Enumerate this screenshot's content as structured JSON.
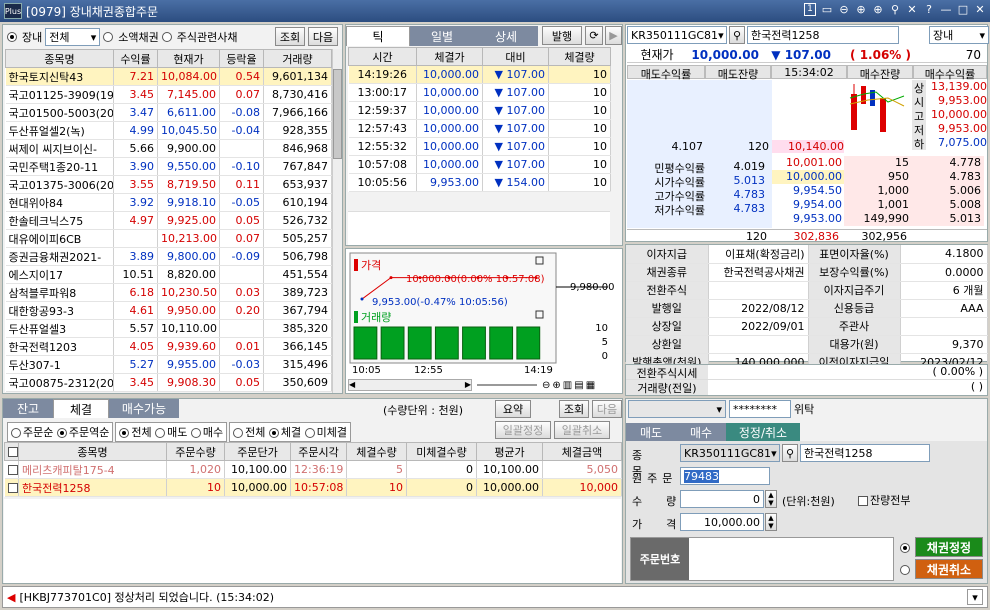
{
  "window": {
    "logo": "Plus",
    "title": "[0979] 장내채권종합주문",
    "controls": [
      "1",
      "▭",
      "⊖",
      "⊕",
      "⊕",
      "⚲",
      "✕",
      "?",
      "—",
      "□",
      "✕"
    ]
  },
  "left": {
    "market_radio": "장내",
    "market_select": "전체",
    "small_radio": "소액채권",
    "stock_radio": "주식관련사채",
    "query_btn": "조회",
    "next_btn": "다음",
    "headers": [
      "종목명",
      "수익률",
      "현재가",
      "등락율",
      "거래량"
    ],
    "rows": [
      {
        "name": "한국토지신탁43",
        "yield": "7.21",
        "price": "10,084.00",
        "chg": "0.54",
        "vol": "9,601,134",
        "color": "red",
        "sel": true
      },
      {
        "name": "국고01125-3909(19-",
        "yield": "3.45",
        "price": "7,145.00",
        "chg": "0.07",
        "vol": "8,730,416",
        "color": "red"
      },
      {
        "name": "국고01500-5003(20-",
        "yield": "3.47",
        "price": "6,611.00",
        "chg": "-0.08",
        "vol": "7,966,166",
        "color": "blue"
      },
      {
        "name": "두산퓨얼셀2(녹)",
        "yield": "4.99",
        "price": "10,045.50",
        "chg": "-0.04",
        "vol": "928,355",
        "color": "blue"
      },
      {
        "name": "써제이 씨지브이신-",
        "yield": "5.66",
        "price": "9,900.00",
        "chg": "",
        "vol": "846,968",
        "color": "black"
      },
      {
        "name": "국민주택1종20-11",
        "yield": "3.90",
        "price": "9,550.00",
        "chg": "-0.10",
        "vol": "767,847",
        "color": "blue"
      },
      {
        "name": "국고01375-3006(20-",
        "yield": "3.55",
        "price": "8,719.50",
        "chg": "0.11",
        "vol": "653,937",
        "color": "red"
      },
      {
        "name": "현대위아84",
        "yield": "3.92",
        "price": "9,918.10",
        "chg": "-0.05",
        "vol": "610,194",
        "color": "blue"
      },
      {
        "name": "한솔테크닉스75",
        "yield": "4.97",
        "price": "9,925.00",
        "chg": "0.05",
        "vol": "526,732",
        "color": "red"
      },
      {
        "name": "대유에이피6CB",
        "yield": "",
        "price": "10,213.00",
        "chg": "0.07",
        "vol": "505,257",
        "color": "red"
      },
      {
        "name": "증권금융채권2021-",
        "yield": "3.89",
        "price": "9,800.00",
        "chg": "-0.09",
        "vol": "506,798",
        "color": "blue"
      },
      {
        "name": "에스지이17",
        "yield": "10.51",
        "price": "8,820.00",
        "chg": "",
        "vol": "451,554",
        "color": "black"
      },
      {
        "name": "삼척블루파워8",
        "yield": "6.18",
        "price": "10,230.50",
        "chg": "0.03",
        "vol": "389,723",
        "color": "red"
      },
      {
        "name": "대한항공93-3",
        "yield": "4.61",
        "price": "9,950.00",
        "chg": "0.20",
        "vol": "367,794",
        "color": "red"
      },
      {
        "name": "두산퓨얼셀3",
        "yield": "5.57",
        "price": "10,110.00",
        "chg": "",
        "vol": "385,320",
        "color": "black"
      },
      {
        "name": "한국전력1203",
        "yield": "4.05",
        "price": "9,939.60",
        "chg": "0.01",
        "vol": "366,145",
        "color": "red"
      },
      {
        "name": "두산307-1",
        "yield": "5.27",
        "price": "9,955.00",
        "chg": "-0.03",
        "vol": "315,496",
        "color": "blue"
      },
      {
        "name": "국고00875-2312(20-",
        "yield": "3.45",
        "price": "9,908.30",
        "chg": "0.05",
        "vol": "350,609",
        "color": "red"
      }
    ]
  },
  "mid": {
    "tabs": [
      "틱",
      "일별",
      "상세"
    ],
    "issue_btn": "발행",
    "headers": [
      "시간",
      "체결가",
      "대비",
      "체결량"
    ],
    "rows": [
      {
        "time": "14:19:26",
        "price": "10,000.00",
        "diff": "▼ 107.00",
        "qty": "10"
      },
      {
        "time": "13:00:17",
        "price": "10,000.00",
        "diff": "▼ 107.00",
        "qty": "10"
      },
      {
        "time": "12:59:37",
        "price": "10,000.00",
        "diff": "▼ 107.00",
        "qty": "10"
      },
      {
        "time": "12:57:43",
        "price": "10,000.00",
        "diff": "▼ 107.00",
        "qty": "10"
      },
      {
        "time": "12:55:32",
        "price": "10,000.00",
        "diff": "▼ 107.00",
        "qty": "10"
      },
      {
        "time": "10:57:08",
        "price": "10,000.00",
        "diff": "▼ 107.00",
        "qty": "10"
      },
      {
        "time": "10:05:56",
        "price": "9,953.00",
        "diff": "▼ 154.00",
        "qty": "10"
      }
    ],
    "chart": {
      "price_label": "가격",
      "volume_label": "거래량",
      "high_note": "10,000.00(0.00% 10:57:08)",
      "low_note": "9,953.00(-0.47% 10:05:56)",
      "y_label": "9,980.00",
      "vol_ticks": [
        "10",
        "5",
        "0"
      ],
      "x_ticks": [
        "10:05",
        "12:55",
        "14:19"
      ]
    }
  },
  "chart_data": {
    "type": "line",
    "x": [
      "10:05:56",
      "10:57:08",
      "12:55:32",
      "12:57:43",
      "12:59:37",
      "13:00:17",
      "14:19:26"
    ],
    "series": [
      {
        "name": "가격",
        "values": [
          9953,
          10000,
          10000,
          10000,
          10000,
          10000,
          10000
        ]
      },
      {
        "name": "거래량",
        "values": [
          10,
          10,
          10,
          10,
          10,
          10,
          10
        ]
      }
    ]
  },
  "right": {
    "code": "KR350111GC81",
    "name": "한국전력1258",
    "market": "장내",
    "cur_label": "현재가",
    "cur_price": "10,000.00",
    "cur_diff": "▼ 107.00",
    "cur_rate": "( 1.06% )",
    "cur_qty": "70",
    "ob_headers": [
      "매도수익률",
      "매도잔량",
      "15:34:02",
      "매수잔량",
      "매수수익률"
    ],
    "ask_yield": "4.107",
    "ask_qty": "120",
    "ask_price": "10,140.00",
    "ohlc": [
      {
        "k": "상",
        "v": "13,139.00"
      },
      {
        "k": "시",
        "v": "9,953.00"
      },
      {
        "k": "고",
        "v": "10,000.00"
      },
      {
        "k": "저",
        "v": "9,953.00"
      },
      {
        "k": "하",
        "v": "7,075.00"
      }
    ],
    "stats": [
      {
        "k": "민평수익률",
        "v": "4.019"
      },
      {
        "k": "시가수익률",
        "v": "5.013"
      },
      {
        "k": "고가수익률",
        "v": "4.783"
      },
      {
        "k": "저가수익률",
        "v": "4.783"
      }
    ],
    "bids": [
      {
        "p": "10,001.00",
        "q": "15",
        "y": "4.778"
      },
      {
        "p": "10,000.00",
        "q": "950",
        "y": "4.783"
      },
      {
        "p": "9,954.50",
        "q": "1,000",
        "y": "5.006"
      },
      {
        "p": "9,954.00",
        "q": "1,001",
        "y": "5.008"
      },
      {
        "p": "9,953.00",
        "q": "149,990",
        "y": "5.013"
      }
    ],
    "tot_ask": "120",
    "tot_mid": "302,836",
    "tot_bid": "302,956",
    "info": [
      [
        "이자지급",
        "이표채(확정금리)",
        "표면이자율(%)",
        "4.1800"
      ],
      [
        "채권종류",
        "한국전력공사채권",
        "보장수익률(%)",
        "0.0000"
      ],
      [
        "전환주식",
        "",
        "이자지급주기",
        "6 개월"
      ],
      [
        "발행일",
        "2022/08/12",
        "신용등급",
        "AAA"
      ],
      [
        "상장일",
        "2022/09/01",
        "주관사",
        ""
      ],
      [
        "상환일",
        "",
        "대용가(원)",
        "9,370"
      ],
      [
        "발행총액(천원)",
        "140,000,000",
        "이전이자지급일",
        "2023/02/12"
      ]
    ],
    "conv_label": "전환주식시세",
    "conv_val": "(  0.00% )",
    "trade_label": "거래량(전일)",
    "trade_val": "(  )"
  },
  "bottom_left": {
    "tabs": [
      "잔고",
      "체결",
      "매수가능"
    ],
    "unit": "(수량단위 : 천원)",
    "summary_btn": "요약",
    "query_btn": "조회",
    "next_btn": "다음",
    "sort_asc": "주문순",
    "sort_desc": "주문역순",
    "f_all": "전체",
    "f_sell": "매도",
    "f_buy": "매수",
    "s_all": "전체",
    "s_done": "체결",
    "s_undone": "미체결",
    "bulk_mod": "일괄정정",
    "bulk_cancel": "일괄취소",
    "headers": [
      "종목명",
      "주문수량",
      "주문단가",
      "주문시각",
      "체결수량",
      "미체결수량",
      "평균가",
      "체결금액"
    ],
    "rows": [
      {
        "name": "메리츠캐피탈175-4",
        "qty": "1,020",
        "price": "10,100.00",
        "time": "12:36:19",
        "done": "5",
        "undone": "0",
        "avg": "10,100.00",
        "amt": "5,050"
      },
      {
        "name": "한국전력1258",
        "qty": "10",
        "price": "10,000.00",
        "time": "10:57:08",
        "done": "10",
        "undone": "0",
        "avg": "10,000.00",
        "amt": "10,000"
      }
    ]
  },
  "order": {
    "account_mask": "********",
    "delegate": "위탁",
    "tabs": [
      "매도",
      "매수",
      "정정/취소"
    ],
    "code_label": "종목",
    "code": "KR350111GC81",
    "name": "한국전력1258",
    "orig_label": "원주문",
    "orig_val": "79483",
    "qty_label": "수량",
    "qty_val": "0",
    "unit": "(단위:천원)",
    "all_remain": "잔량전부",
    "price_label": "가격",
    "price_val": "10,000.00",
    "order_no": "주문번호",
    "mod_btn": "채권정정",
    "cancel_btn": "채권취소"
  },
  "status": {
    "msg": "[HKBJ773701C0] 정상처리 되었습니다. (15:34:02)"
  },
  "colors": {
    "up": "#d40000",
    "down": "#0030c0",
    "header": "#e8e8e8",
    "chart_bg": "#f8f8f8",
    "vol_bar": "#00a020",
    "green_btn": "#1a8a1a",
    "orange_btn": "#d06010"
  }
}
